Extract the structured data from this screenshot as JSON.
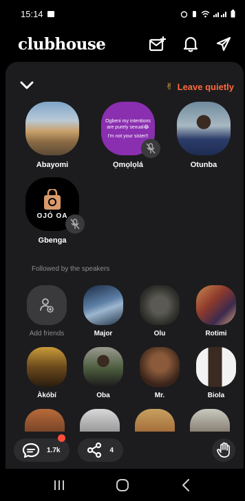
{
  "status": {
    "time": "15:14"
  },
  "header": {
    "logo": "clubhouse"
  },
  "room": {
    "leave_label": "Leave quietly",
    "leave_emoji": "✌",
    "speakers": [
      {
        "name": "Abayomi",
        "muted": false
      },
      {
        "name": "Ọmọlọlá",
        "muted": true,
        "card_text": "Ogbeni my intentions are purely sexual😂",
        "card_text2": "I'm not your sister!!"
      },
      {
        "name": "Otunba",
        "muted": false
      },
      {
        "name": "Gbenga",
        "muted": true,
        "logo_text": "OJÓ OA"
      }
    ],
    "followed_label": "Followed by the speakers",
    "listeners": [
      {
        "name": "Add friends"
      },
      {
        "name": "Major"
      },
      {
        "name": "Olu"
      },
      {
        "name": "Rotimi"
      },
      {
        "name": "Àkóbí"
      },
      {
        "name": "Oba"
      },
      {
        "name": "Mr."
      },
      {
        "name": "Biola"
      }
    ]
  },
  "bottom": {
    "chat_count": "1.7k",
    "share_count": "4"
  },
  "colors": {
    "accent": "#ff6a3d",
    "panel": "#1c1c1e",
    "badge": "#ff4f3a"
  }
}
